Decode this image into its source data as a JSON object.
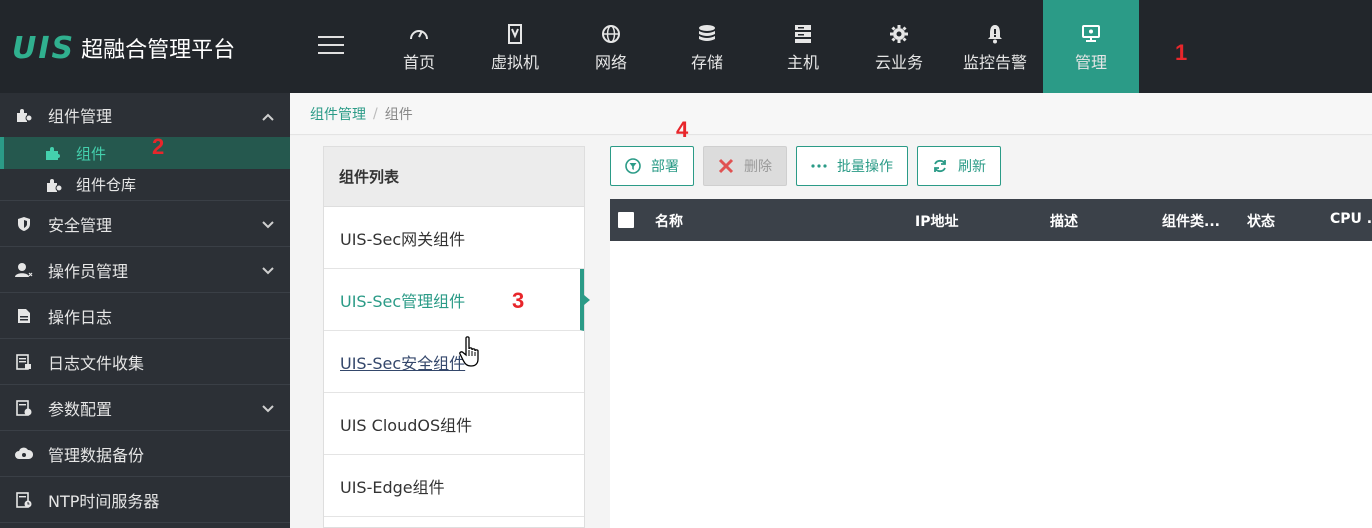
{
  "app": {
    "logo_mark": "UIS",
    "logo_text": "超融合管理平台"
  },
  "topnav": {
    "items": [
      {
        "label": "首页",
        "icon": "dashboard-icon"
      },
      {
        "label": "虚拟机",
        "icon": "vm-icon"
      },
      {
        "label": "网络",
        "icon": "globe-icon"
      },
      {
        "label": "存储",
        "icon": "database-icon"
      },
      {
        "label": "主机",
        "icon": "server-icon"
      },
      {
        "label": "云业务",
        "icon": "gear-icon"
      },
      {
        "label": "监控告警",
        "icon": "bell-alert-icon"
      },
      {
        "label": "管理",
        "icon": "monitor-icon",
        "active": true
      }
    ]
  },
  "markers": {
    "m1": "1",
    "m2": "2",
    "m3": "3",
    "m4": "4"
  },
  "sidebar": {
    "group": {
      "label": "组件管理",
      "icon": "puzzle-gear-icon",
      "expanded": true
    },
    "sub_items": [
      {
        "label": "组件",
        "icon": "puzzle-icon",
        "active": true
      },
      {
        "label": "组件仓库",
        "icon": "puzzle-gear-icon"
      }
    ],
    "items": [
      {
        "label": "安全管理",
        "icon": "shield-icon",
        "has_children": true
      },
      {
        "label": "操作员管理",
        "icon": "user-icon",
        "has_children": true
      },
      {
        "label": "操作日志",
        "icon": "document-icon",
        "has_children": false
      },
      {
        "label": "日志文件收集",
        "icon": "log-collect-icon",
        "has_children": false
      },
      {
        "label": "参数配置",
        "icon": "config-icon",
        "has_children": true
      },
      {
        "label": "管理数据备份",
        "icon": "cloud-backup-icon",
        "has_children": false
      },
      {
        "label": "NTP时间服务器",
        "icon": "clock-doc-icon",
        "has_children": false
      }
    ]
  },
  "breadcrumb": {
    "parent": "组件管理",
    "separator": "/",
    "current": "组件"
  },
  "component_list": {
    "title": "组件列表",
    "items": [
      {
        "label": "UIS-Sec网关组件"
      },
      {
        "label": "UIS-Sec管理组件",
        "active": true
      },
      {
        "label": "UIS-Sec安全组件",
        "hover": true
      },
      {
        "label": "UIS CloudOS组件"
      },
      {
        "label": "UIS-Edge组件"
      }
    ]
  },
  "toolbar": {
    "deploy": "部署",
    "delete": "删除",
    "batch": "批量操作",
    "refresh": "刷新"
  },
  "table": {
    "columns": [
      "名称",
      "IP地址",
      "描述",
      "组件类...",
      "状态",
      "CPU ..."
    ]
  },
  "colors": {
    "accent": "#2b9b87",
    "topbar": "#22262b",
    "sidebar": "#2c3036",
    "marker": "#e8262b"
  }
}
